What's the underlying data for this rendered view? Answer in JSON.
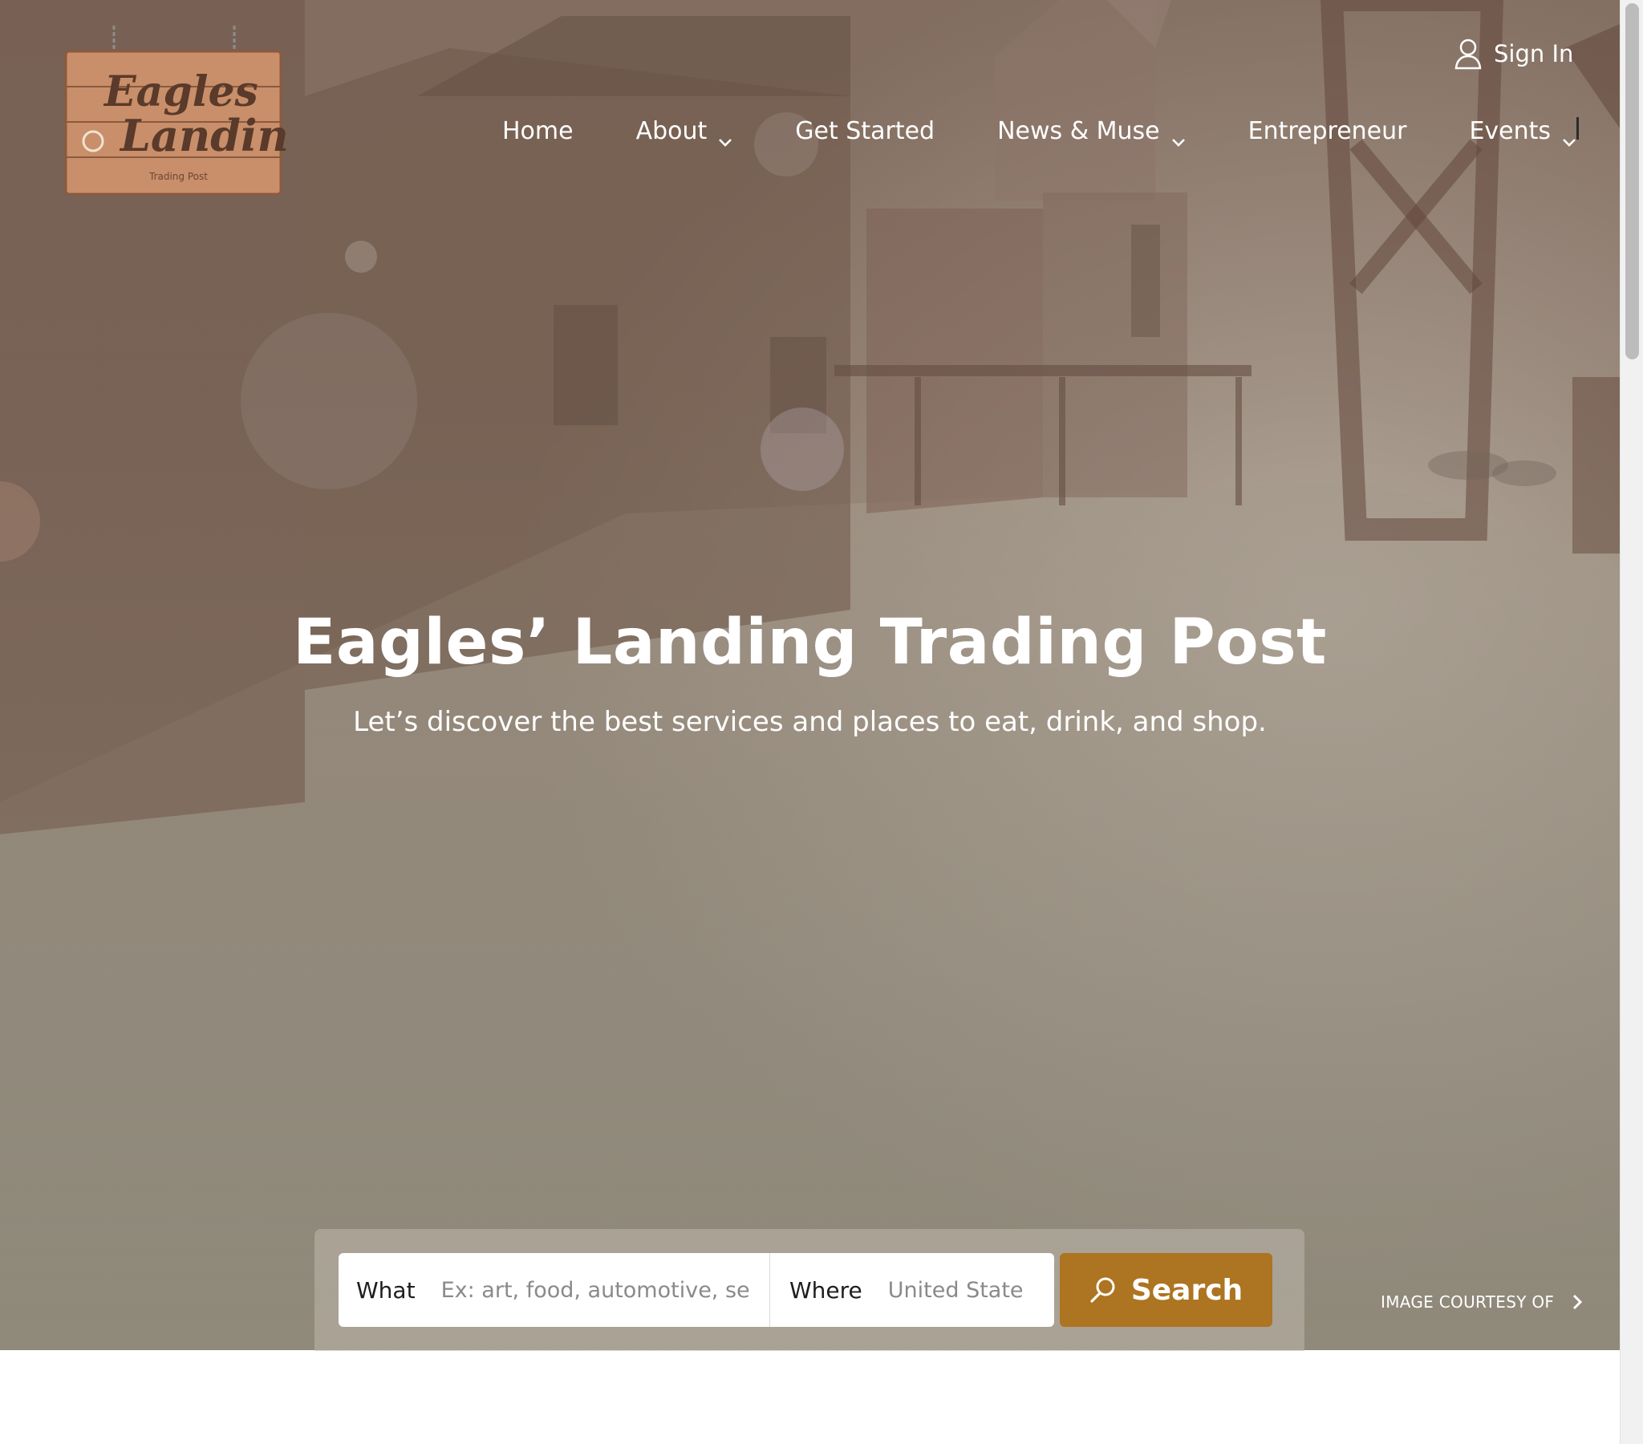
{
  "site": {
    "logo_text_line1": "Eagles",
    "logo_text_line2": "Landing",
    "logo_subtext": "Trading Post"
  },
  "header": {
    "signin_label": "Sign In",
    "signin_icon": "user-icon",
    "nav": [
      {
        "label": "Home",
        "has_dropdown": false
      },
      {
        "label": "About",
        "has_dropdown": true
      },
      {
        "label": "Get Started",
        "has_dropdown": false
      },
      {
        "label": "News & Muse",
        "has_dropdown": true
      },
      {
        "label": "Entrepreneur",
        "has_dropdown": false
      },
      {
        "label": "Events",
        "has_dropdown": true
      }
    ]
  },
  "hero": {
    "title": "Eagles’ Landing Trading Post",
    "subtitle": "Let’s discover the best services and places to eat, drink, and shop."
  },
  "search": {
    "what_label": "What",
    "what_placeholder": "Ex: art, food, automotive, services",
    "where_label": "Where",
    "where_placeholder": "United States",
    "button_label": "Search",
    "button_icon": "search-icon"
  },
  "image_credit": {
    "label": "IMAGE COURTESY OF",
    "icon": "chevron-right-icon"
  },
  "colors": {
    "accent": "#ad7421",
    "text_on_hero": "#ffffff"
  }
}
